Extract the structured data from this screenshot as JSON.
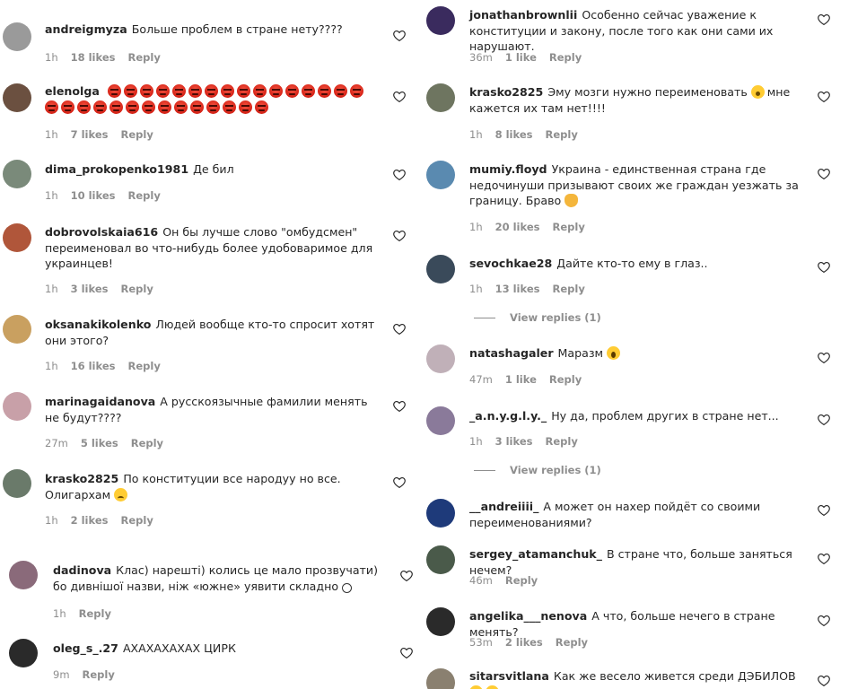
{
  "left": [
    {
      "user": "andreigmyza",
      "text": "Больше проблем в стране нету????",
      "emoji": [],
      "time": "1h",
      "likes": "18 likes",
      "reply": "Reply"
    },
    {
      "user": "elenolga",
      "text": "",
      "emoji": [
        "angry",
        "angry",
        "angry",
        "angry",
        "angry",
        "angry",
        "angry",
        "angry",
        "angry",
        "angry",
        "angry",
        "angry",
        "angry",
        "angry",
        "angry",
        "angry",
        "angry",
        "angry",
        "angry",
        "angry",
        "angry",
        "angry",
        "angry",
        "angry",
        "angry",
        "angry",
        "angry",
        "angry",
        "angry",
        "angry"
      ],
      "time": "1h",
      "likes": "7 likes",
      "reply": "Reply"
    },
    {
      "user": "dima_prokopenko1981",
      "text": "Де бил",
      "emoji": [],
      "time": "1h",
      "likes": "10 likes",
      "reply": "Reply"
    },
    {
      "user": "dobrovolskaia616",
      "text": "Он бы лучше слово \"омбудсмен\" переименовал во что-нибудь более удобоваримое для украинцев!",
      "emoji": [],
      "time": "1h",
      "likes": "3 likes",
      "reply": "Reply"
    },
    {
      "user": "oksanakikolenko",
      "text": "Людей вообще кто-то спросит хотят они этого?",
      "emoji": [],
      "time": "1h",
      "likes": "16 likes",
      "reply": "Reply"
    },
    {
      "user": "marinagaidanova",
      "text": "А русскоязычные фамилии менять не будут????",
      "emoji": [],
      "time": "27m",
      "likes": "5 likes",
      "reply": "Reply"
    },
    {
      "user": "krasko2825",
      "text": "По конституции все народуу но все. Олигархам",
      "emoji": [
        "sad"
      ],
      "time": "1h",
      "likes": "2 likes",
      "reply": "Reply"
    },
    {
      "user": "dadinova",
      "text": "Клас) нарешті) колись це мало прозвучати) бо дивнішої назви, ніж «южне» уявити складно",
      "emoji": [
        "smile"
      ],
      "time": "1h",
      "likes": "",
      "reply": "Reply"
    },
    {
      "user": "oleg_s_.27",
      "text": "АХАХАХАХАХ ЦИРК",
      "emoji": [],
      "time": "9m",
      "likes": "",
      "reply": "Reply"
    }
  ],
  "right": [
    {
      "user": "jonathanbrownlii",
      "text": "Особенно сейчас уважение к конституции и закону, после того как они сами их нарушают.",
      "emoji": [],
      "time": "36m",
      "likes": "1 like",
      "reply": "Reply"
    },
    {
      "user": "krasko2825",
      "text": "Эму мозги нужно переименовать",
      "emoji": [
        "wow"
      ],
      "text2": "мне кажется их там нет!!!!",
      "time": "1h",
      "likes": "8 likes",
      "reply": "Reply"
    },
    {
      "user": "mumiy.floyd",
      "text": "Украина - единственная страна где недочинуши призывают своих же граждан уезжать за границу. Браво",
      "emoji": [
        "clap"
      ],
      "time": "1h",
      "likes": "20 likes",
      "reply": "Reply"
    },
    {
      "user": "sevochkae28",
      "text": "Дайте кто-то ему в глаз..",
      "emoji": [],
      "time": "1h",
      "likes": "13 likes",
      "reply": "Reply",
      "view_replies": "View replies (1)"
    },
    {
      "user": "natashagaler",
      "text": "Маразм",
      "emoji": [
        "scream"
      ],
      "time": "47m",
      "likes": "1 like",
      "reply": "Reply"
    },
    {
      "user": "_a.n.y.g.l.y._",
      "text": "Ну да, проблем других в стране нет...",
      "emoji": [],
      "time": "1h",
      "likes": "3 likes",
      "reply": "Reply",
      "view_replies": "View replies (1)"
    },
    {
      "user": "__andreiiii_",
      "text": "А может он нахер пойдёт со своими переименованиями?",
      "emoji": [],
      "time": "",
      "likes": "",
      "reply": ""
    },
    {
      "user": "sergey_atamanchuk_",
      "text": "В стране что, больше заняться нечем?",
      "emoji": [],
      "time": "46m",
      "likes": "",
      "reply": "Reply"
    },
    {
      "user": "angelika___nenova",
      "text": "А что, больше нечего в стране менять?",
      "emoji": [],
      "time": "53m",
      "likes": "2 likes",
      "reply": "Reply"
    },
    {
      "user": "sitarsvitlana",
      "text": "Как же весело живется среди ДЭБИЛОВ",
      "emoji": [
        "laugh",
        "laugh"
      ],
      "time": "",
      "likes": "",
      "reply": ""
    }
  ],
  "colors": {
    "text": "#262626",
    "meta": "#8e8e8e",
    "angry": "#d62216"
  }
}
